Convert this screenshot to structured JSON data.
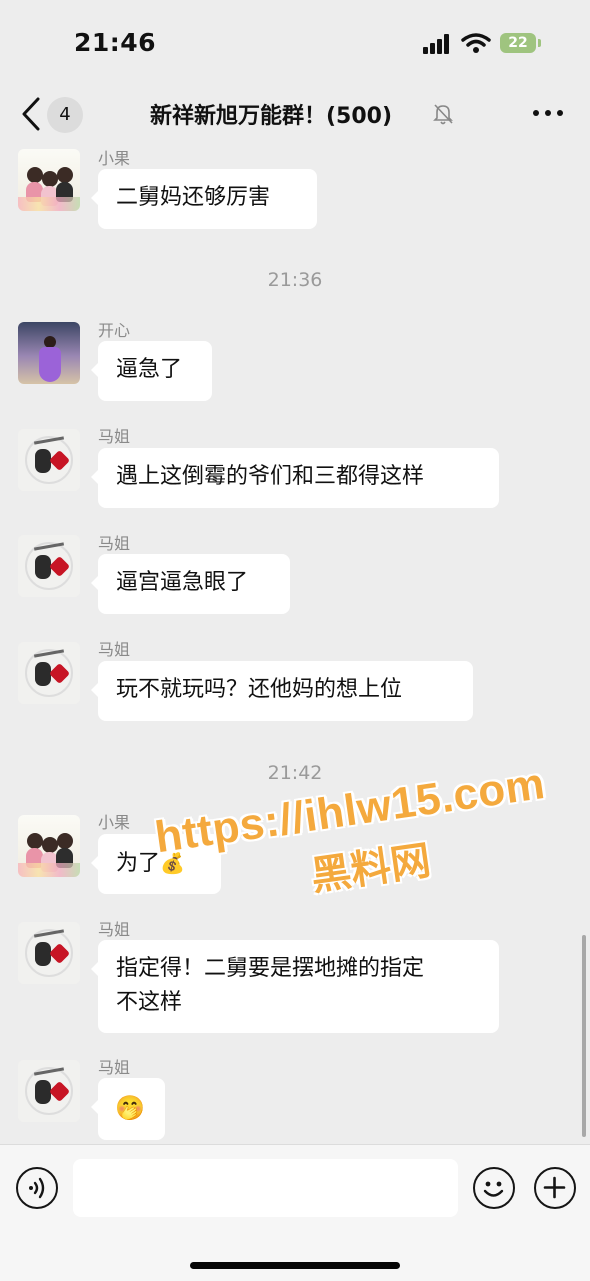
{
  "status_bar": {
    "time": "21:46",
    "battery": "22"
  },
  "nav": {
    "unread_count": "4",
    "title": "新祥新旭万能群！(500)"
  },
  "messages": [
    {
      "sender": "小果",
      "text": "二舅妈还够厉害"
    },
    {
      "time": "21:36"
    },
    {
      "sender": "开心",
      "text": "逼急了"
    },
    {
      "sender": "马姐",
      "text": "遇上这倒霉的爷们和三都得这样"
    },
    {
      "sender": "马姐",
      "text": "逼宫逼急眼了"
    },
    {
      "sender": "马姐",
      "text": "玩不就玩吗？还他妈的想上位"
    },
    {
      "time": "21:42"
    },
    {
      "sender": "小果",
      "text": "为了",
      "emoji": "💰"
    },
    {
      "sender": "马姐",
      "text_line1": "指定得！二舅要是摆地摊的指定",
      "text_line2": "不这样"
    },
    {
      "sender": "马姐",
      "emoji": "🤭"
    }
  ],
  "watermark": {
    "url": "https://ihlw15.com",
    "sub": "黑料网"
  }
}
